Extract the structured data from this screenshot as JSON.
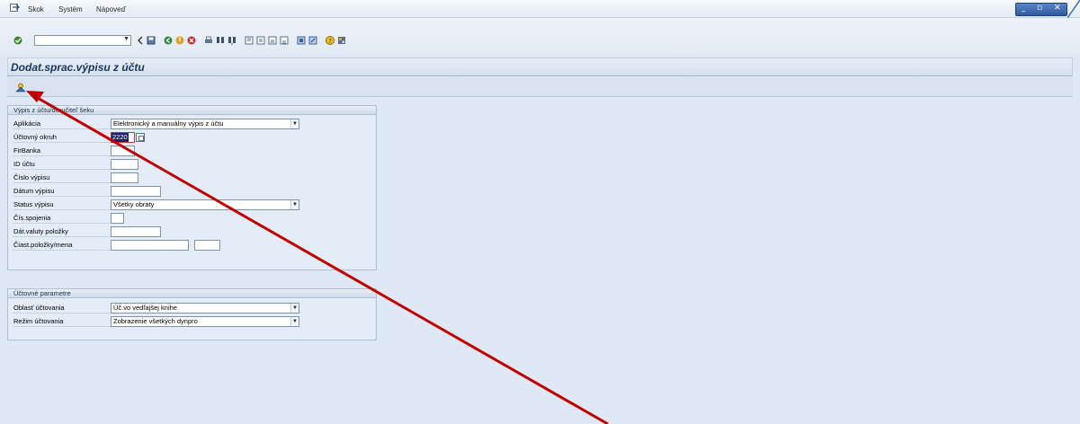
{
  "menu": {
    "items": [
      {
        "label": "Skok"
      },
      {
        "label": "Systém"
      },
      {
        "label": "Nápoveď"
      }
    ]
  },
  "window_controls": {
    "minimize": "_",
    "restore": "▫",
    "close": "✕"
  },
  "toolbar": {
    "command_field_value": "",
    "icons": [
      "enter-icon",
      "back-icon",
      "save-icon",
      "back-green-icon",
      "exit-icon",
      "cancel-icon",
      "print-icon",
      "find-icon",
      "find-next-icon",
      "first-page-icon",
      "previous-page-icon",
      "next-page-icon",
      "last-page-icon",
      "create-session-icon",
      "shortcut-icon",
      "help-icon",
      "customize-layout-icon"
    ]
  },
  "screen": {
    "title": "Dodat.sprac.výpisu z účtu",
    "execute_icon": "execute-icon"
  },
  "group1": {
    "title": "Výpis z účtu/doručiteľ šeku",
    "fields": [
      {
        "label": "Aplikácia",
        "value": "Elektronický a manuálny výpis z účtu"
      },
      {
        "label": "Účtovný okruh",
        "value": "2220"
      },
      {
        "label": "FirBanka",
        "value": ""
      },
      {
        "label": "ID účtu",
        "value": ""
      },
      {
        "label": "Číslo výpisu",
        "value": ""
      },
      {
        "label": "Dátum výpisu",
        "value": ""
      },
      {
        "label": "Status výpisu",
        "value": "Všetky obraty"
      },
      {
        "label": "Čís.spojenia",
        "value": ""
      },
      {
        "label": "Dát.valuty položky",
        "value": ""
      },
      {
        "label": "Čiast.položky/mena",
        "value": "",
        "value2": ""
      }
    ]
  },
  "group2": {
    "title": "Účtovné parametre",
    "fields": [
      {
        "label": "Oblasť účtovania",
        "value": "Úč.vo vedľajšej knihe"
      },
      {
        "label": "Režim účtovania",
        "value": "Zobrazenie všetkých dynpro"
      }
    ]
  },
  "colors": {
    "background": "#dfe9f5",
    "title": "#18365e",
    "annotation_arrow": "#c00000",
    "selection": "#14246a"
  }
}
